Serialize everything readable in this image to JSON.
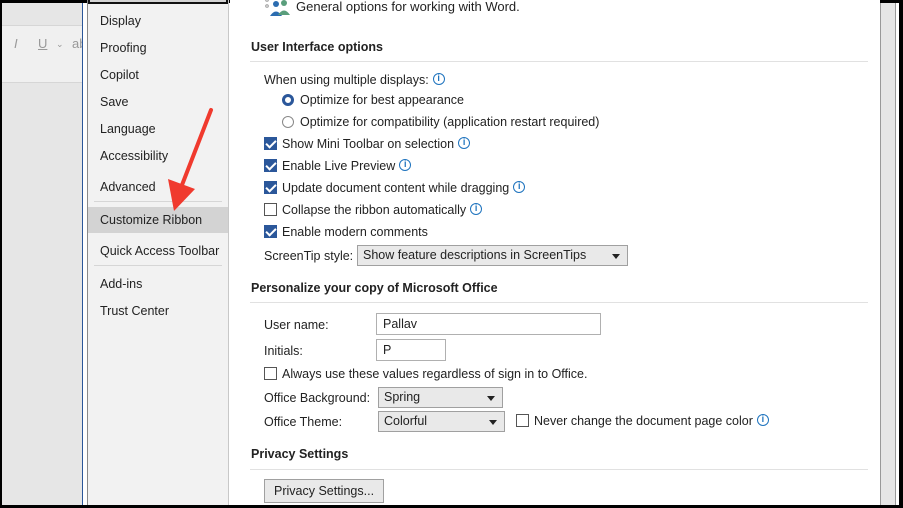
{
  "word_toolbar": {
    "italic": "I",
    "underline": "U",
    "more": "ab"
  },
  "sidebar": {
    "items": [
      {
        "label": "Display"
      },
      {
        "label": "Proofing"
      },
      {
        "label": "Copilot"
      },
      {
        "label": "Save"
      },
      {
        "label": "Language"
      },
      {
        "label": "Accessibility"
      },
      {
        "label": "Advanced"
      },
      {
        "label": "Customize Ribbon"
      },
      {
        "label": "Quick Access Toolbar"
      },
      {
        "label": "Add-ins"
      },
      {
        "label": "Trust Center"
      }
    ]
  },
  "main": {
    "intro": "General options for working with Word.",
    "ui_options": {
      "heading": "User Interface options",
      "multi_display_label": "When using multiple displays:",
      "radio_best": "Optimize for best appearance",
      "radio_compat": "Optimize for compatibility (application restart required)",
      "checkboxes": [
        {
          "label": "Show Mini Toolbar on selection",
          "checked": true
        },
        {
          "label": "Enable Live Preview",
          "checked": true
        },
        {
          "label": "Update document content while dragging",
          "checked": true
        },
        {
          "label": "Collapse the ribbon automatically",
          "checked": false
        },
        {
          "label": "Enable modern comments",
          "checked": true
        }
      ],
      "screentip_label": "ScreenTip style:",
      "screentip_value": "Show feature descriptions in ScreenTips"
    },
    "personalize": {
      "heading": "Personalize your copy of Microsoft Office",
      "username_label": "User name:",
      "username_value": "Pallav",
      "initials_label": "Initials:",
      "initials_value": "P",
      "always_use": "Always use these values regardless of sign in to Office.",
      "background_label": "Office Background:",
      "background_value": "Spring",
      "theme_label": "Office Theme:",
      "theme_value": "Colorful",
      "never_change": "Never change the document page color"
    },
    "privacy": {
      "heading": "Privacy Settings",
      "button": "Privacy Settings..."
    }
  },
  "colors": {
    "accent": "#2b579a",
    "info": "#1e73be",
    "arrow": "#f03a2e"
  }
}
